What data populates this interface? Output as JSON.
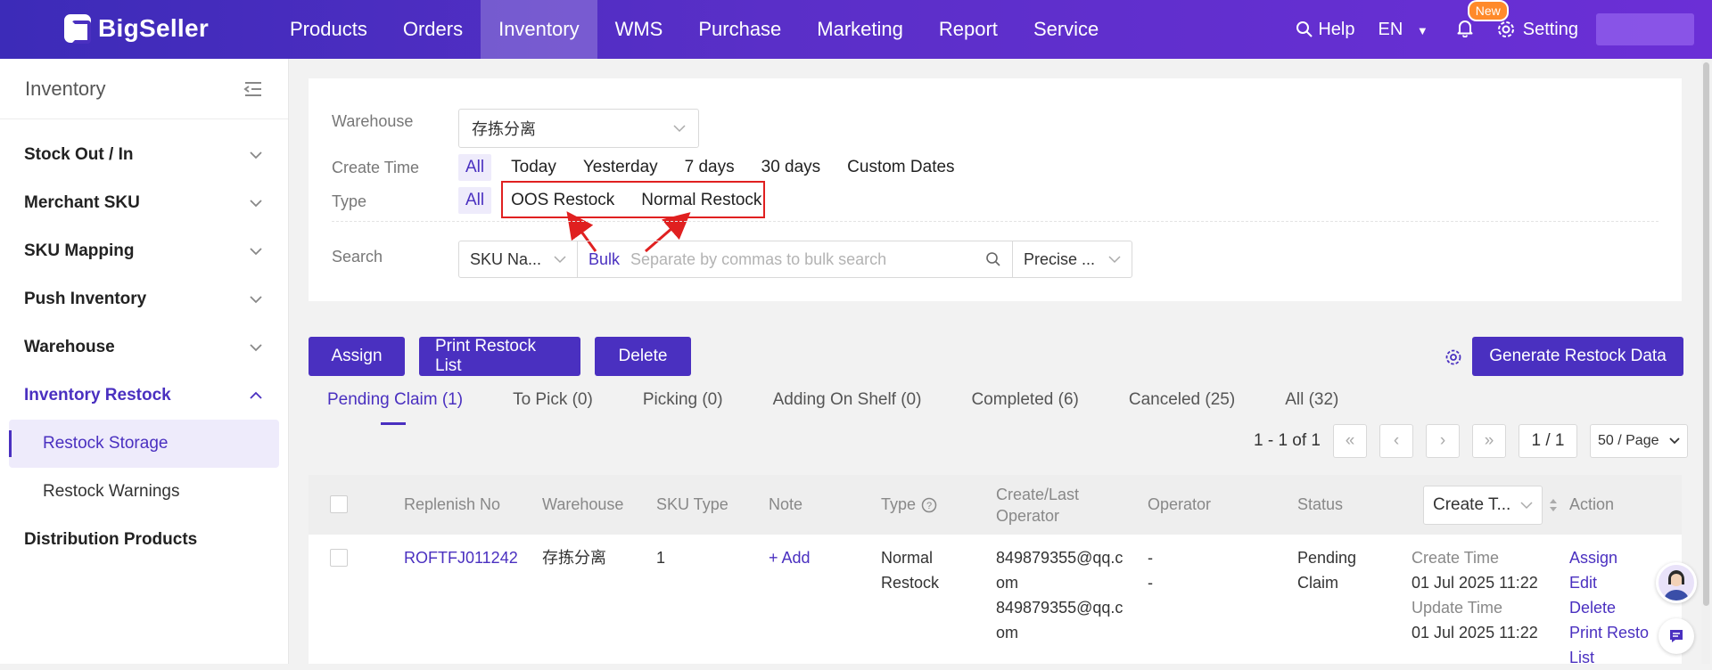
{
  "brand": {
    "logo_text": "BigSeller"
  },
  "topnav": {
    "items": [
      {
        "label": "Products"
      },
      {
        "label": "Orders"
      },
      {
        "label": "Inventory",
        "active": true
      },
      {
        "label": "WMS"
      },
      {
        "label": "Purchase"
      },
      {
        "label": "Marketing"
      },
      {
        "label": "Report"
      },
      {
        "label": "Service"
      }
    ],
    "help_label": "Help",
    "lang_label": "EN",
    "notification_badge": "New",
    "setting_label": "Setting"
  },
  "sidebar": {
    "title": "Inventory",
    "items": [
      {
        "label": "Stock Out / In"
      },
      {
        "label": "Merchant SKU"
      },
      {
        "label": "SKU Mapping"
      },
      {
        "label": "Push Inventory"
      },
      {
        "label": "Warehouse"
      },
      {
        "label": "Inventory Restock",
        "open": true
      }
    ],
    "sub_items": [
      {
        "label": "Restock Storage",
        "active": true
      },
      {
        "label": "Restock Warnings"
      }
    ],
    "extra_item": {
      "label": "Distribution Products"
    }
  },
  "filters": {
    "warehouse_label": "Warehouse",
    "warehouse_value": "存拣分离",
    "create_time_label": "Create Time",
    "create_time_options": [
      "All",
      "Today",
      "Yesterday",
      "7 days",
      "30 days",
      "Custom Dates"
    ],
    "type_label": "Type",
    "type_all": "All",
    "type_options": [
      "OOS Restock",
      "Normal Restock"
    ],
    "search_label": "Search",
    "search_field": "SKU Na...",
    "bulk_label": "Bulk",
    "search_placeholder": "Separate by commas to bulk search",
    "match_mode": "Precise ..."
  },
  "actions": {
    "assign": "Assign",
    "print_restock_list": "Print Restock List",
    "delete": "Delete",
    "generate": "Generate Restock Data"
  },
  "tabs": [
    {
      "label": "Pending Claim (1)",
      "active": true
    },
    {
      "label": "To Pick (0)"
    },
    {
      "label": "Picking (0)"
    },
    {
      "label": "Adding On Shelf (0)"
    },
    {
      "label": "Completed (6)"
    },
    {
      "label": "Canceled (25)"
    },
    {
      "label": "All (32)"
    }
  ],
  "pagination": {
    "range": "1 - 1 of 1",
    "page": "1 / 1",
    "page_size": "50 / Page"
  },
  "table": {
    "headers": {
      "replenish_no": "Replenish No",
      "warehouse": "Warehouse",
      "sku_type": "SKU Type",
      "note": "Note",
      "type": "Type",
      "create_last_operator_1": "Create/Last",
      "create_last_operator_2": "Operator",
      "operator": "Operator",
      "status": "Status",
      "sort_by": "Create T...",
      "action": "Action"
    },
    "rows": [
      {
        "replenish_no": "ROFTFJ011242",
        "warehouse": "存拣分离",
        "sku_type": "1",
        "note_add": "Add",
        "type_line1": "Normal",
        "type_line2": "Restock",
        "op1_a": "849879355@qq.c",
        "op1_b": "om",
        "op2_a": "849879355@qq.c",
        "op2_b": "om",
        "operator1": "-",
        "operator2": "-",
        "status_line1": "Pending",
        "status_line2": "Claim",
        "create_time_label": "Create Time",
        "create_time": "01 Jul 2025 11:22",
        "update_time_label": "Update Time",
        "update_time": "01 Jul 2025 11:22",
        "actions": [
          "Assign",
          "Edit",
          "Delete",
          "Print Resto",
          "List"
        ]
      }
    ]
  },
  "colors": {
    "accent": "#4a30c0",
    "highlight_box": "#e02020"
  }
}
